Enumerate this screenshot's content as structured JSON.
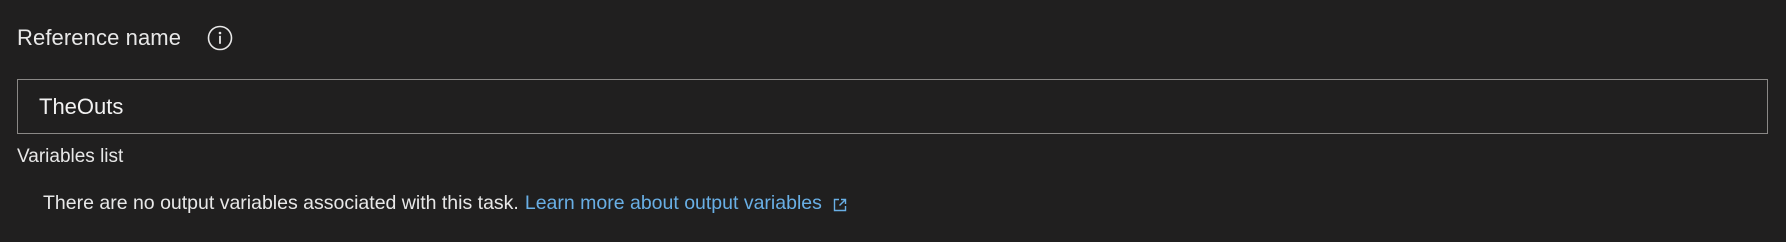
{
  "reference": {
    "label": "Reference name",
    "info_icon": "info-icon",
    "value": "TheOuts"
  },
  "variables": {
    "label": "Variables list",
    "empty_message": "There are no output variables associated with this task.",
    "learn_more_link": "Learn more about output variables",
    "link_icon": "external-link-icon",
    "link_color": "#69afe5"
  },
  "colors": {
    "background": "#201f1f",
    "text": "#e8e8e8",
    "input_border": "#8a8886"
  }
}
